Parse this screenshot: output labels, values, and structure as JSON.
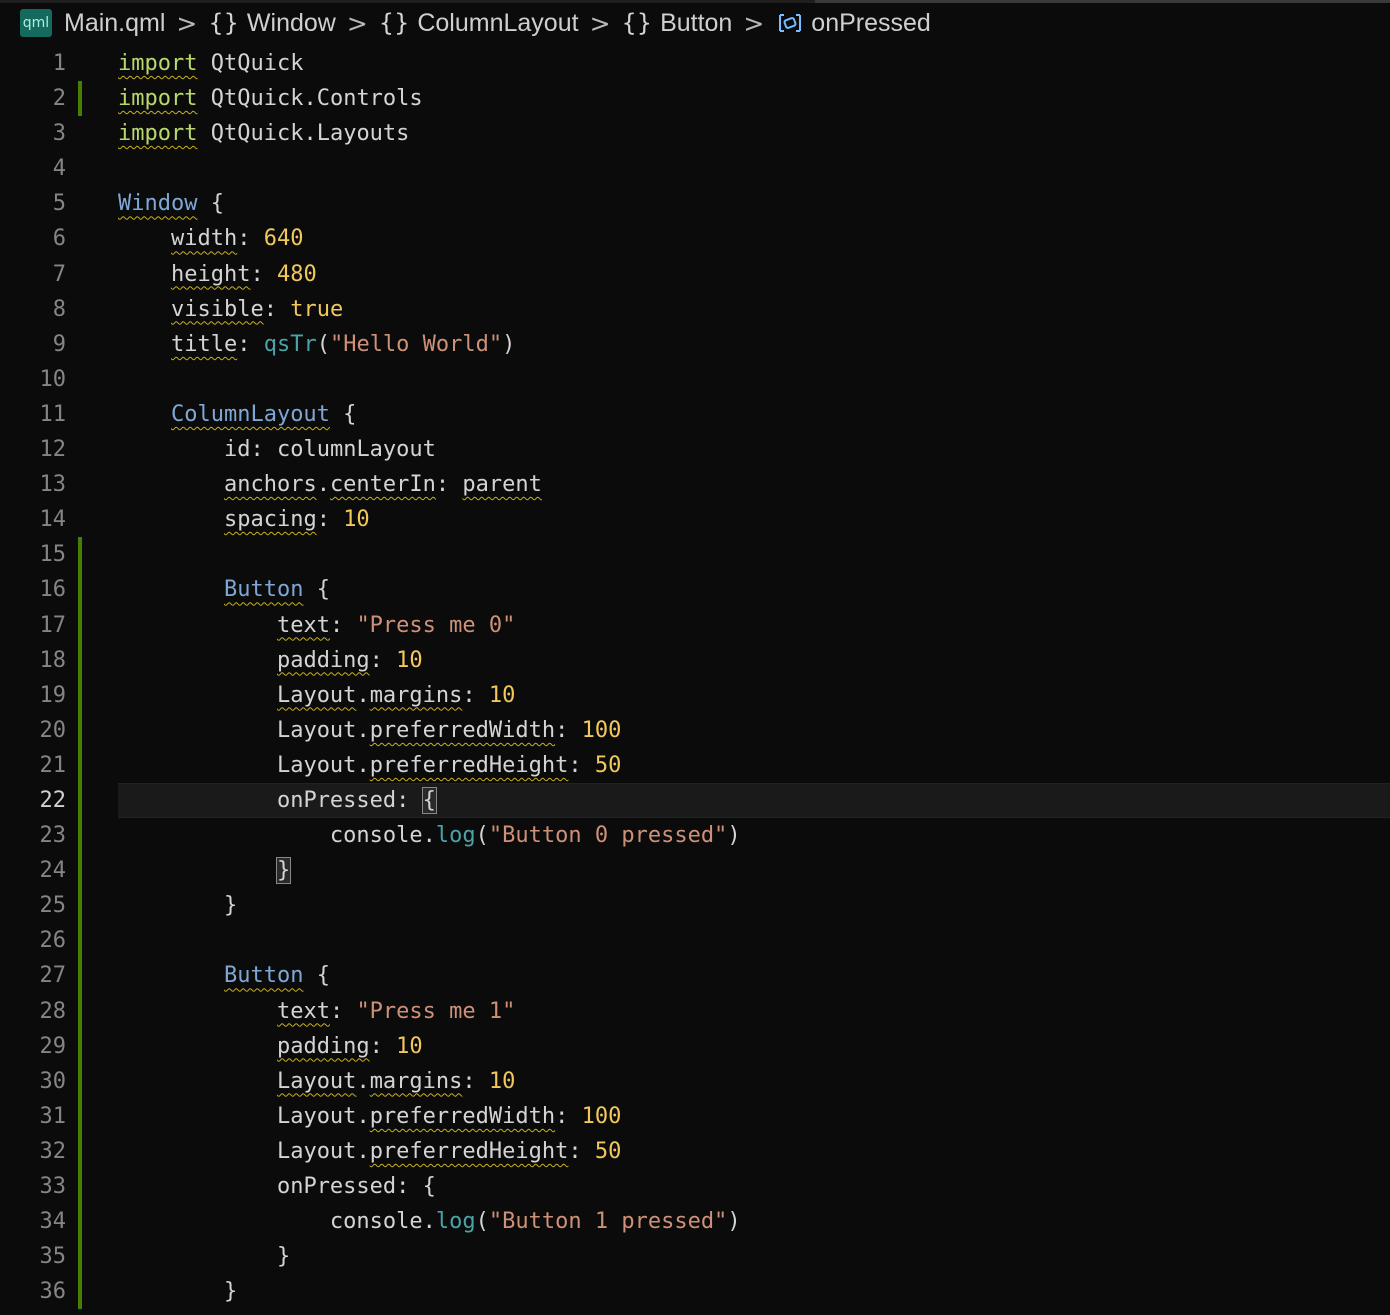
{
  "breadcrumb": {
    "file_icon_text": "qml",
    "file": "Main.qml",
    "items": [
      "Window",
      "ColumnLayout",
      "Button"
    ],
    "braces_glyph": "{}",
    "current": "onPressed",
    "separator": ">"
  },
  "colors": {
    "background": "#0b0b0b",
    "line_number": "#858585",
    "keyword": "#b8d86b",
    "type": "#7fa7d6",
    "number": "#f2c85b",
    "string": "#ce9178",
    "function": "#4aa3a8",
    "gutter_modified": "#487e02",
    "squiggle": "#c9b21c"
  },
  "editor": {
    "current_line": 22,
    "lines": [
      {
        "n": "1",
        "t": "import QtQuick"
      },
      {
        "n": "2",
        "t": "import QtQuick.Controls"
      },
      {
        "n": "3",
        "t": "import QtQuick.Layouts"
      },
      {
        "n": "4",
        "t": ""
      },
      {
        "n": "5",
        "t": "Window {"
      },
      {
        "n": "6",
        "t": "    width: 640"
      },
      {
        "n": "7",
        "t": "    height: 480"
      },
      {
        "n": "8",
        "t": "    visible: true"
      },
      {
        "n": "9",
        "t": "    title: qsTr(\"Hello World\")"
      },
      {
        "n": "10",
        "t": ""
      },
      {
        "n": "11",
        "t": "    ColumnLayout {"
      },
      {
        "n": "12",
        "t": "        id: columnLayout"
      },
      {
        "n": "13",
        "t": "        anchors.centerIn: parent"
      },
      {
        "n": "14",
        "t": "        spacing: 10"
      },
      {
        "n": "15",
        "t": ""
      },
      {
        "n": "16",
        "t": "        Button {"
      },
      {
        "n": "17",
        "t": "            text: \"Press me 0\""
      },
      {
        "n": "18",
        "t": "            padding: 10"
      },
      {
        "n": "19",
        "t": "            Layout.margins: 10"
      },
      {
        "n": "20",
        "t": "            Layout.preferredWidth: 100"
      },
      {
        "n": "21",
        "t": "            Layout.preferredHeight: 50"
      },
      {
        "n": "22",
        "t": "            onPressed: {"
      },
      {
        "n": "23",
        "t": "                console.log(\"Button 0 pressed\")"
      },
      {
        "n": "24",
        "t": "            }"
      },
      {
        "n": "25",
        "t": "        }"
      },
      {
        "n": "26",
        "t": ""
      },
      {
        "n": "27",
        "t": "        Button {"
      },
      {
        "n": "28",
        "t": "            text: \"Press me 1\""
      },
      {
        "n": "29",
        "t": "            padding: 10"
      },
      {
        "n": "30",
        "t": "            Layout.margins: 10"
      },
      {
        "n": "31",
        "t": "            Layout.preferredWidth: 100"
      },
      {
        "n": "32",
        "t": "            Layout.preferredHeight: 50"
      },
      {
        "n": "33",
        "t": "            onPressed: {"
      },
      {
        "n": "34",
        "t": "                console.log(\"Button 1 pressed\")"
      },
      {
        "n": "35",
        "t": "            }"
      },
      {
        "n": "36",
        "t": "        }"
      }
    ]
  }
}
